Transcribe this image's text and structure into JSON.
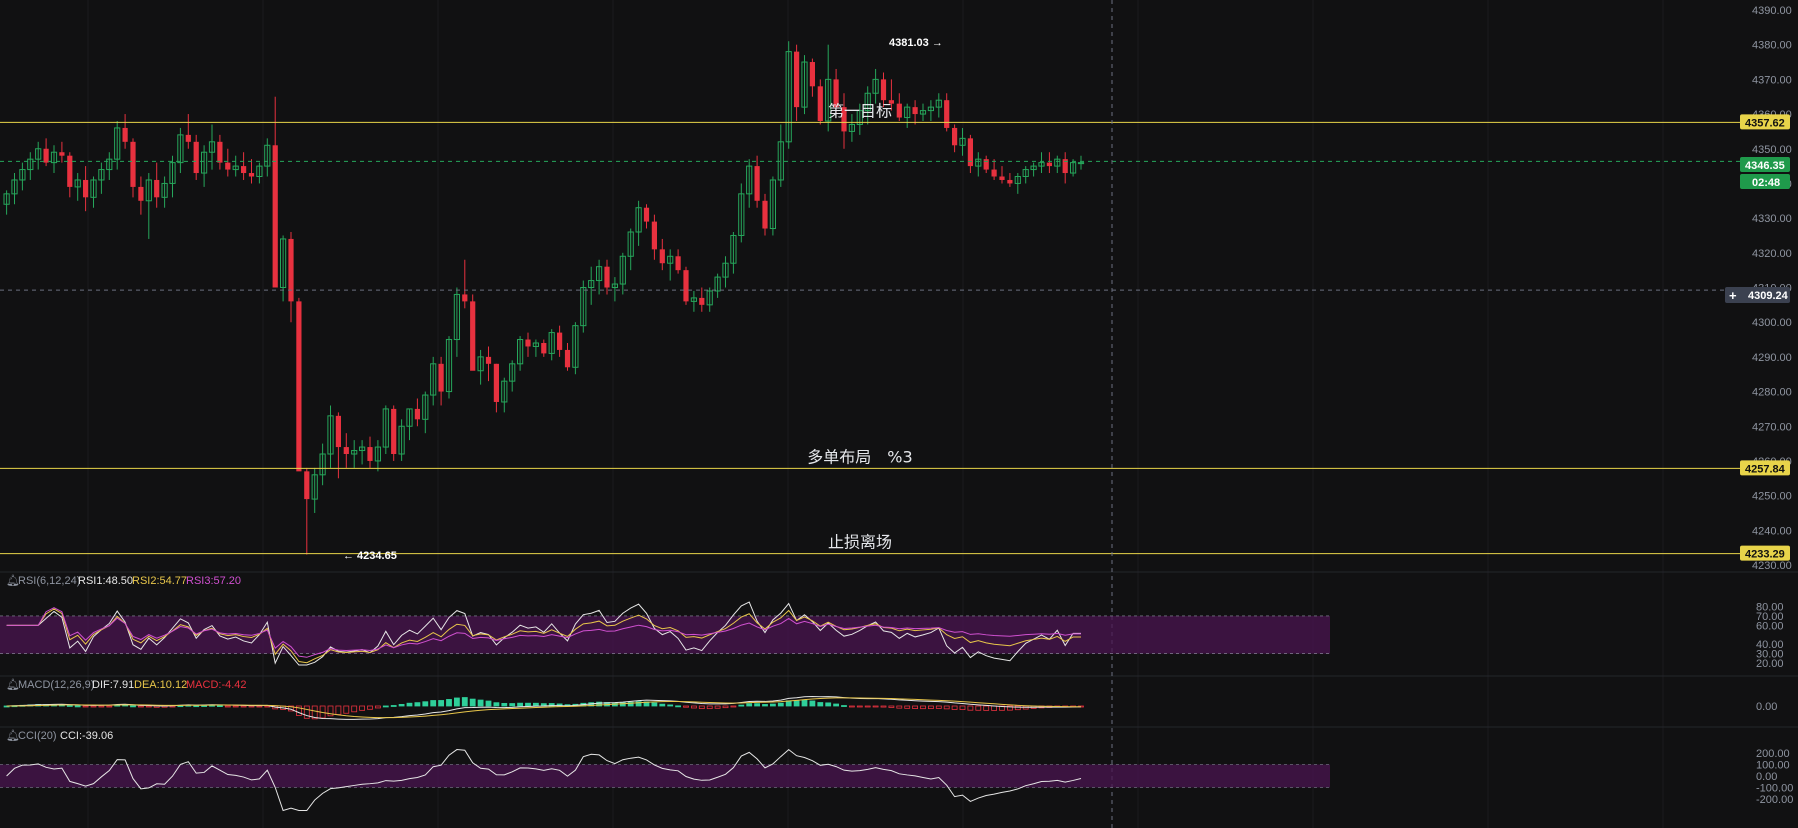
{
  "colors": {
    "background": "#111112",
    "up": "#26a65b",
    "down": "#e8313f",
    "level_line": "#e8d44a",
    "level_tag_bg": "#e8d44a",
    "current_tag_bg": "#1f9a4b",
    "crosshair_tag_bg": "#3b4150",
    "rsi1": "#e6e6e6",
    "rsi2": "#e8c64a",
    "rsi3": "#d050d0",
    "dif": "#e6e6e6",
    "dea": "#e8c64a",
    "macd_up": "#2fcf9a",
    "macd_down": "#e8313f",
    "cci": "#e6e6e6",
    "band": "#4a1450"
  },
  "price_axis": {
    "ticks": [
      "4390.00",
      "4380.00",
      "4370.00",
      "4360.00",
      "4350.00",
      "4340.00",
      "4330.00",
      "4320.00",
      "4310.00",
      "4300.00",
      "4290.00",
      "4280.00",
      "4270.00",
      "4260.00",
      "4250.00",
      "4240.00",
      "4230.00"
    ]
  },
  "levels": [
    {
      "name": "target-1",
      "price": 4357.62,
      "label": "第一目标",
      "tag": "4357.62"
    },
    {
      "name": "long-setup",
      "price": 4257.84,
      "label": "多单布局　%3",
      "tag": "4257.84"
    },
    {
      "name": "stop-loss",
      "price": 4233.29,
      "label": "止损离场",
      "tag": "4233.29"
    }
  ],
  "current": {
    "price": 4346.35,
    "tag": "4346.35",
    "countdown": "02:48"
  },
  "crosshair": {
    "price": 4309.24,
    "tag": "4309.24",
    "plus": "+"
  },
  "markers": {
    "high": "4381.03 →",
    "low": "← 4234.65"
  },
  "rsi": {
    "title": "RSI(6,12,24)",
    "rsi1": "RSI1:48.50",
    "rsi2": "RSI2:54.77",
    "rsi3": "RSI3:57.20",
    "ticks": [
      "80.00",
      "70.00",
      "60.00",
      "40.00",
      "30.00",
      "20.00"
    ]
  },
  "macd": {
    "title": "MACD(12,26,9)",
    "dif": "DIF:7.91",
    "dea": "DEA:10.12",
    "macd": "MACD:-4.42",
    "ticks": [
      "0.00"
    ]
  },
  "cci": {
    "title": "CCI(20)",
    "value": "CCI:-39.06",
    "ticks": [
      "200.00",
      "100.00",
      "0.00",
      "-100.00",
      "-200.00"
    ]
  },
  "chart_data": {
    "type": "candlestick",
    "title": "",
    "y_range": [
      4230,
      4390
    ],
    "candles": [
      [
        4334,
        4338,
        4331,
        4337
      ],
      [
        4337,
        4343,
        4334,
        4341
      ],
      [
        4341,
        4346,
        4338,
        4344
      ],
      [
        4344,
        4349,
        4341,
        4347
      ],
      [
        4347,
        4352,
        4344,
        4350
      ],
      [
        4350,
        4353,
        4345,
        4346
      ],
      [
        4346,
        4351,
        4343,
        4349
      ],
      [
        4349,
        4352,
        4346,
        4348
      ],
      [
        4348,
        4349,
        4336,
        4339
      ],
      [
        4339,
        4343,
        4335,
        4341
      ],
      [
        4341,
        4345,
        4332,
        4336
      ],
      [
        4336,
        4342,
        4333,
        4341
      ],
      [
        4341,
        4346,
        4337,
        4344
      ],
      [
        4344,
        4349,
        4341,
        4347
      ],
      [
        4347,
        4358,
        4344,
        4356
      ],
      [
        4356,
        4360,
        4350,
        4352
      ],
      [
        4352,
        4353,
        4336,
        4339
      ],
      [
        4339,
        4342,
        4331,
        4335
      ],
      [
        4335,
        4343,
        4324,
        4341
      ],
      [
        4341,
        4346,
        4333,
        4336
      ],
      [
        4336,
        4342,
        4333,
        4340
      ],
      [
        4340,
        4348,
        4336,
        4346
      ],
      [
        4346,
        4356,
        4343,
        4354
      ],
      [
        4354,
        4360,
        4350,
        4352
      ],
      [
        4352,
        4354,
        4341,
        4343
      ],
      [
        4343,
        4351,
        4339,
        4349
      ],
      [
        4349,
        4357,
        4344,
        4352
      ],
      [
        4352,
        4354,
        4344,
        4346
      ],
      [
        4346,
        4350,
        4342,
        4344
      ],
      [
        4344,
        4348,
        4342,
        4345
      ],
      [
        4345,
        4349,
        4341,
        4343
      ],
      [
        4343,
        4347,
        4340,
        4342
      ],
      [
        4342,
        4346,
        4340,
        4345
      ],
      [
        4345,
        4353,
        4342,
        4351
      ],
      [
        4351,
        4365,
        4340,
        4310
      ],
      [
        4310,
        4325,
        4306,
        4324
      ],
      [
        4324,
        4326,
        4300,
        4306
      ],
      [
        4306,
        4307,
        4261,
        4257
      ],
      [
        4257,
        4258,
        4233,
        4249
      ],
      [
        4249,
        4258,
        4245,
        4256
      ],
      [
        4256,
        4265,
        4253,
        4262
      ],
      [
        4262,
        4276,
        4258,
        4273
      ],
      [
        4273,
        4274,
        4255,
        4264
      ],
      [
        4264,
        4268,
        4258,
        4262
      ],
      [
        4262,
        4266,
        4258,
        4263
      ],
      [
        4263,
        4266,
        4259,
        4264
      ],
      [
        4264,
        4267,
        4258,
        4260
      ],
      [
        4260,
        4266,
        4257,
        4264
      ],
      [
        4264,
        4276,
        4262,
        4275
      ],
      [
        4275,
        4276,
        4260,
        4262
      ],
      [
        4262,
        4272,
        4260,
        4270
      ],
      [
        4270,
        4275,
        4266,
        4275
      ],
      [
        4275,
        4278,
        4270,
        4272
      ],
      [
        4272,
        4280,
        4268,
        4279
      ],
      [
        4279,
        4290,
        4276,
        4288
      ],
      [
        4288,
        4290,
        4276,
        4280
      ],
      [
        4280,
        4296,
        4278,
        4295
      ],
      [
        4295,
        4310,
        4290,
        4308
      ],
      [
        4308,
        4318,
        4304,
        4306
      ],
      [
        4306,
        4308,
        4290,
        4286
      ],
      [
        4286,
        4292,
        4282,
        4290
      ],
      [
        4290,
        4293,
        4283,
        4288
      ],
      [
        4288,
        4288,
        4274,
        4277
      ],
      [
        4277,
        4284,
        4274,
        4283
      ],
      [
        4283,
        4289,
        4280,
        4288
      ],
      [
        4288,
        4296,
        4286,
        4295
      ],
      [
        4295,
        4297,
        4290,
        4293
      ],
      [
        4293,
        4295,
        4290,
        4294
      ],
      [
        4294,
        4295,
        4290,
        4291
      ],
      [
        4291,
        4298,
        4289,
        4297
      ],
      [
        4297,
        4299,
        4290,
        4292
      ],
      [
        4292,
        4294,
        4286,
        4287
      ],
      [
        4287,
        4300,
        4285,
        4299
      ],
      [
        4299,
        4312,
        4297,
        4310
      ],
      [
        4310,
        4316,
        4305,
        4312
      ],
      [
        4312,
        4318,
        4308,
        4316
      ],
      [
        4316,
        4318,
        4308,
        4310
      ],
      [
        4310,
        4313,
        4306,
        4311
      ],
      [
        4311,
        4320,
        4308,
        4319
      ],
      [
        4319,
        4327,
        4315,
        4326
      ],
      [
        4326,
        4335,
        4322,
        4333
      ],
      [
        4333,
        4334,
        4327,
        4329
      ],
      [
        4329,
        4331,
        4318,
        4321
      ],
      [
        4321,
        4324,
        4315,
        4317
      ],
      [
        4317,
        4321,
        4312,
        4319
      ],
      [
        4319,
        4321,
        4314,
        4315
      ],
      [
        4315,
        4316,
        4305,
        4306
      ],
      [
        4306,
        4309,
        4303,
        4307
      ],
      [
        4307,
        4310,
        4303,
        4305
      ],
      [
        4305,
        4310,
        4303,
        4309
      ],
      [
        4309,
        4314,
        4307,
        4313
      ],
      [
        4313,
        4319,
        4310,
        4317
      ],
      [
        4317,
        4326,
        4314,
        4325
      ],
      [
        4325,
        4340,
        4323,
        4337
      ],
      [
        4337,
        4347,
        4333,
        4345
      ],
      [
        4345,
        4348,
        4333,
        4335
      ],
      [
        4335,
        4337,
        4325,
        4327
      ],
      [
        4327,
        4342,
        4325,
        4341
      ],
      [
        4341,
        4357,
        4339,
        4352
      ],
      [
        4352,
        4381,
        4350,
        4378
      ],
      [
        4378,
        4380,
        4358,
        4362
      ],
      [
        4362,
        4377,
        4360,
        4375
      ],
      [
        4375,
        4376,
        4365,
        4368
      ],
      [
        4368,
        4370,
        4357,
        4358
      ],
      [
        4358,
        4380,
        4355,
        4370
      ],
      [
        4370,
        4373,
        4360,
        4362
      ],
      [
        4362,
        4366,
        4350,
        4355
      ],
      [
        4355,
        4360,
        4352,
        4357
      ],
      [
        4357,
        4363,
        4354,
        4361
      ],
      [
        4361,
        4368,
        4357,
        4366
      ],
      [
        4366,
        4373,
        4363,
        4370
      ],
      [
        4370,
        4372,
        4362,
        4364
      ],
      [
        4364,
        4370,
        4361,
        4363
      ],
      [
        4363,
        4366,
        4358,
        4359
      ],
      [
        4359,
        4363,
        4356,
        4362
      ],
      [
        4362,
        4364,
        4357,
        4360
      ],
      [
        4360,
        4363,
        4358,
        4361
      ],
      [
        4361,
        4364,
        4358,
        4362
      ],
      [
        4362,
        4366,
        4359,
        4364
      ],
      [
        4364,
        4366,
        4355,
        4356
      ],
      [
        4356,
        4357,
        4349,
        4351
      ],
      [
        4351,
        4356,
        4348,
        4353
      ],
      [
        4353,
        4354,
        4343,
        4345
      ],
      [
        4345,
        4349,
        4342,
        4347
      ],
      [
        4347,
        4348,
        4343,
        4344
      ],
      [
        4344,
        4347,
        4341,
        4342
      ],
      [
        4342,
        4345,
        4340,
        4341
      ],
      [
        4341,
        4343,
        4339,
        4340
      ],
      [
        4340,
        4343,
        4337,
        4342
      ],
      [
        4342,
        4345,
        4340,
        4344
      ],
      [
        4344,
        4346,
        4342,
        4345
      ],
      [
        4345,
        4349,
        4343,
        4346
      ],
      [
        4346,
        4349,
        4343,
        4345
      ],
      [
        4345,
        4348,
        4343,
        4347
      ],
      [
        4347,
        4349,
        4340,
        4343
      ],
      [
        4343,
        4347,
        4342,
        4346
      ],
      [
        4346,
        4348,
        4344,
        4346
      ]
    ]
  }
}
